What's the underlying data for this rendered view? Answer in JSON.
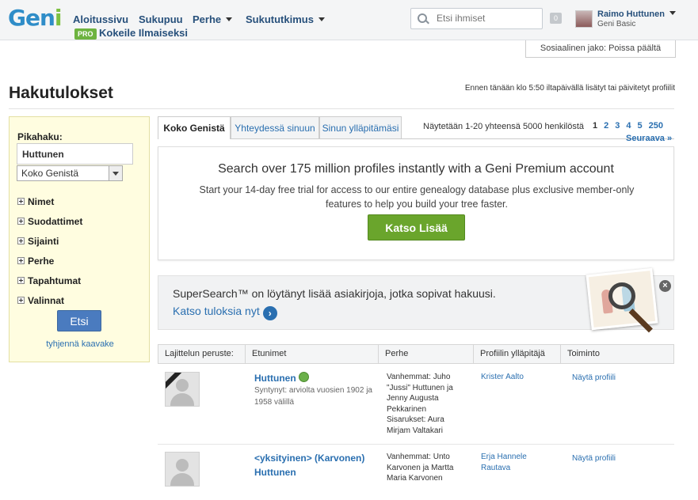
{
  "header": {
    "logo": "Geni",
    "nav": [
      {
        "label": "Aloitussivu"
      },
      {
        "label": "Sukupuu"
      },
      {
        "label": "Perhe"
      },
      {
        "label": "Sukututkimus"
      }
    ],
    "pro_badge": "PRO",
    "try_free": "Kokeile Ilmaiseksi",
    "search_placeholder": "Etsi ihmiset",
    "notifications": "0",
    "user_name": "Raimo Huttunen",
    "user_plan": "Geni Basic",
    "social_sharing": "Sosiaalinen jako: Poissa päältä"
  },
  "page": {
    "title": "Hakutulokset",
    "updated_note": "Ennen tänään klo 5:50 iltapäivällä lisätyt tai päivitetyt profiilit"
  },
  "sidebar": {
    "quick_search_label": "Pikahaku:",
    "query": "Huttunen",
    "scope": "Koko Genistä",
    "sections": [
      "Nimet",
      "Suodattimet",
      "Sijainti",
      "Perhe",
      "Tapahtumat",
      "Valinnat"
    ],
    "search_button": "Etsi",
    "clear_link": "tyhjennä kaavake"
  },
  "tabs": [
    "Koko Genistä",
    "Yhteydessä sinuun",
    "Sinun ylläpitämäsi"
  ],
  "results": {
    "showing": "Näytetään 1-20 yhteensä 5000 henkilöstä",
    "pages": [
      "1",
      "2",
      "3",
      "4",
      "5",
      "250"
    ],
    "next": "Seuraava »"
  },
  "promo": {
    "title": "Search over 175 million profiles instantly with a Geni Premium account",
    "desc": "Start your 14-day free trial for access to our entire genealogy database plus exclusive member-only features to help you build your tree faster.",
    "button": "Katso Lisää"
  },
  "supersearch": {
    "text": "SuperSearch™ on löytänyt lisää asiakirjoja, jotka sopivat hakuusi.",
    "link": "Katso tuloksia nyt"
  },
  "table": {
    "headers": [
      "Lajittelun peruste:",
      "Etunimet",
      "Perhe",
      "Profiilin ylläpitäjä",
      "Toiminto"
    ],
    "rows": [
      {
        "name": "Huttunen",
        "born": "Syntynyt: arviolta vuosien 1902 ja 1958 välillä",
        "family": "Vanhemmat: Juho \"Jussi\" Huttunen ja Jenny Augusta Pekkarinen\nSisarukset: Aura Mirjam Valtakari",
        "manager": "Krister Aalto",
        "action": "Näytä profiili"
      },
      {
        "name": "<yksityinen> (Karvonen) Huttunen",
        "born": "",
        "family": "Vanhemmat: Unto Karvonen ja Martta Maria Karvonen",
        "manager": "Erja Hannele Rautava",
        "action": "Näytä profiili"
      }
    ]
  }
}
